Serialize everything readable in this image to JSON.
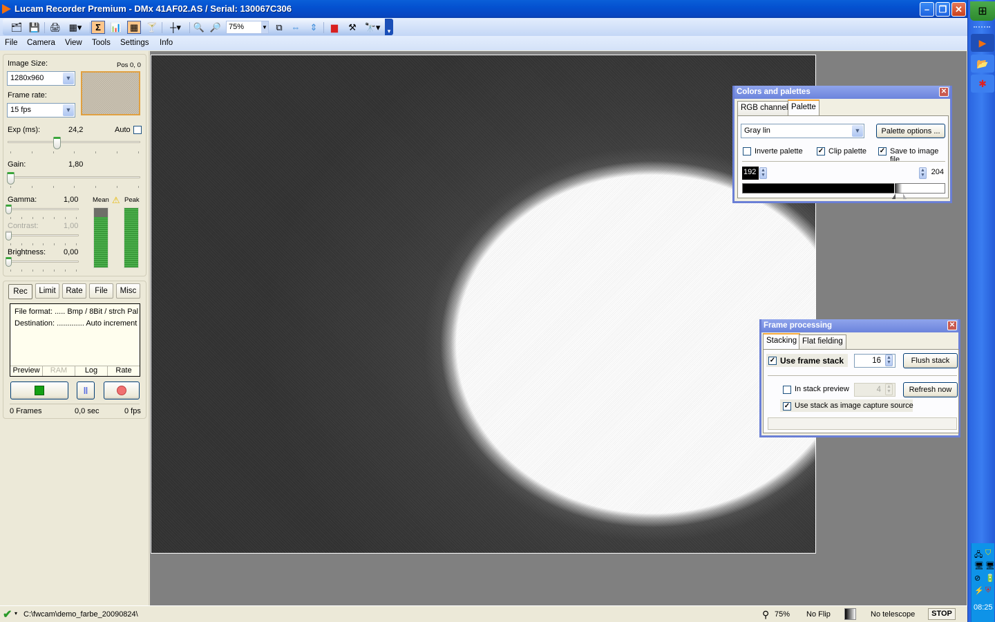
{
  "window": {
    "title": "Lucam Recorder Premium - DMx 41AF02.AS / Serial: 130067C306",
    "controls": {
      "minimize": "–",
      "restore": "❐",
      "close": "✕"
    }
  },
  "toolbar": {
    "zoom_value": "75%",
    "icons": [
      "open-icon",
      "save-icon",
      "print-icon",
      "color-grid-icon",
      "sum-icon",
      "histogram-icon",
      "grid-view-icon",
      "filter-icon",
      "crosshair-icon",
      "zoom-in-icon",
      "zoom-out-icon",
      "fit-window-icon",
      "fit-width-icon",
      "fit-height-icon",
      "monitor-icon",
      "tools-icon",
      "telescope-icon"
    ]
  },
  "menu": [
    "File",
    "Camera",
    "View",
    "Tools",
    "Settings",
    "Info"
  ],
  "left": {
    "image_size_label": "Image Size:",
    "image_size_value": "1280x960",
    "pos_label": "Pos 0, 0",
    "frame_rate_label": "Frame rate:",
    "frame_rate_value": "15 fps",
    "exp_label": "Exp (ms):",
    "exp_value": "24,2",
    "auto_label": "Auto",
    "auto_checked": false,
    "gain_label": "Gain:",
    "gain_value": "1,80",
    "gamma_label": "Gamma:",
    "gamma_value": "1,00",
    "contrast_label": "Contrast:",
    "contrast_value": "1,00",
    "brightness_label": "Brightness:",
    "brightness_value": "0,00",
    "mean_label": "Mean",
    "peak_label": "Peak",
    "mean_level_pct": 85,
    "peak_level_pct": 100,
    "rec_tabs": [
      "Rec",
      "Limit",
      "Rate",
      "File",
      "Misc"
    ],
    "info_lines": [
      "File format: ..... Bmp / 8Bit / strch Pal",
      "Destination: ............. Auto increment"
    ],
    "info_tabs": [
      "Preview",
      "RAM",
      "Log",
      "Rate"
    ],
    "frames": "0 Frames",
    "seconds": "0,0 sec",
    "fps": "0 fps"
  },
  "colors_panel": {
    "title": "Colors and palettes",
    "tabs": [
      "RGB channels",
      "Palette"
    ],
    "active_tab": "Palette",
    "palette_value": "Gray lin",
    "palette_options_label": "Palette options ...",
    "inverte_label": "Inverte palette",
    "inverte_checked": false,
    "clip_label": "Clip palette",
    "clip_checked": true,
    "save_label": "Save to image file",
    "save_checked": true,
    "low_value": "192",
    "high_value": "204"
  },
  "frame_panel": {
    "title": "Frame processing",
    "tabs": [
      "Stacking",
      "Flat fielding"
    ],
    "active_tab": "Stacking",
    "use_stack_label": "Use frame stack",
    "use_stack_checked": true,
    "stack_count": "16",
    "flush_label": "Flush stack",
    "in_stack_preview_label": "In stack preview",
    "in_stack_preview_checked": false,
    "preview_count": "4",
    "refresh_label": "Refresh now",
    "use_as_source_label": "Use stack as image capture source",
    "use_as_source_checked": true
  },
  "status": {
    "path": "C:\\fwcam\\demo_farbe_20090824\\",
    "zoom": "75%",
    "flip": "No Flip",
    "telescope": "No telescope",
    "stop_label": "STOP"
  },
  "taskbar": {
    "clock": "08:25"
  }
}
